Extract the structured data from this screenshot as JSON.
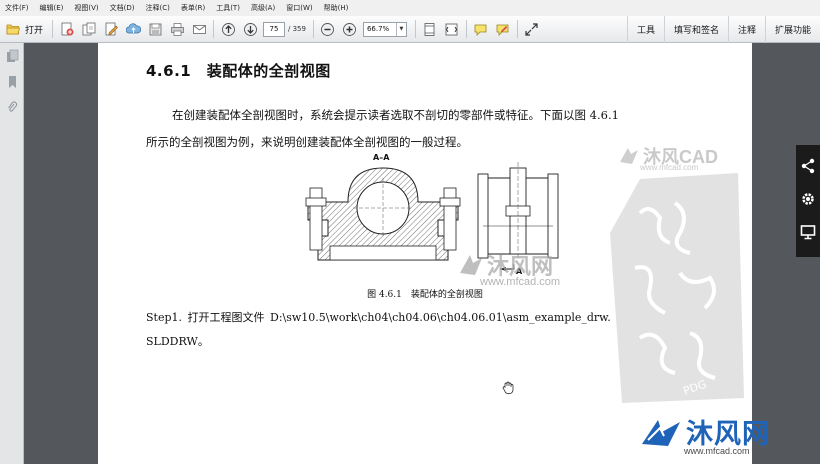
{
  "menu": {
    "items": [
      "文件(F)",
      "编辑(E)",
      "视图(V)",
      "文档(D)",
      "注释(C)",
      "表单(R)",
      "工具(T)",
      "高级(A)",
      "窗口(W)",
      "帮助(H)"
    ]
  },
  "toolbar": {
    "open_label": "打开",
    "page_current": "75",
    "page_total": "/ 359",
    "zoom_value": "66.7%",
    "right_links": [
      "工具",
      "填写和签名",
      "注释",
      "扩展功能"
    ]
  },
  "document": {
    "heading": "4.6.1　装配体的全剖视图",
    "paragraph_line1": "在创建装配体全剖视图时，系统会提示读者选取不剖切的零部件或特征。下面以图 4.6.1",
    "paragraph_line2": "所示的全剖视图为例，来说明创建装配体全剖视图的一般过程。",
    "figure_section_label": "A–A",
    "figure_arrow_label": "A",
    "figure_caption": "图 4.6.1　装配体的全剖视图",
    "step_line1": "Step1.  打开工程图文件  D:\\sw10.5\\work\\ch04\\ch04.06\\ch04.06.01\\asm_example_drw.",
    "step_line2": "SLDDRW。"
  },
  "watermarks": {
    "top_brand": "沐风CAD",
    "top_url": "www.mfcad.com",
    "center_brand": "沐风网",
    "center_url": "www.mfcad.com",
    "bottom_brand": "沐风网",
    "bottom_url": "www.mfcad.com",
    "seal_tag": "PDG"
  },
  "colors": {
    "brand_blue": "#1f63b8",
    "viewer_background": "#54575c"
  }
}
